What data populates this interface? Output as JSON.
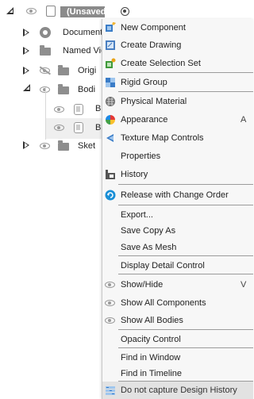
{
  "tree": {
    "root_label": "(Unsaved)",
    "items": [
      {
        "label": "Document"
      },
      {
        "label": "Named Vie"
      },
      {
        "label": "Origi"
      },
      {
        "label": "Bodi"
      },
      {
        "label": "B"
      },
      {
        "label": "B"
      },
      {
        "label": "Sket"
      }
    ]
  },
  "menu": {
    "items": [
      {
        "label": "New Component",
        "icon": "new-component-icon"
      },
      {
        "label": "Create Drawing",
        "icon": "create-drawing-icon"
      },
      {
        "label": "Create Selection Set",
        "icon": "selection-set-icon"
      },
      {
        "label": "Rigid Group",
        "icon": "rigid-group-icon"
      },
      {
        "label": "Physical Material",
        "icon": "physical-material-icon"
      },
      {
        "label": "Appearance",
        "icon": "appearance-icon",
        "shortcut": "A"
      },
      {
        "label": "Texture Map Controls",
        "icon": "texture-map-icon"
      },
      {
        "label": "Properties"
      },
      {
        "label": "History",
        "icon": "history-icon"
      },
      {
        "label": "Release with Change Order",
        "icon": "release-icon"
      },
      {
        "label": "Export..."
      },
      {
        "label": "Save Copy As"
      },
      {
        "label": "Save As Mesh"
      },
      {
        "label": "Display Detail Control"
      },
      {
        "label": "Show/Hide",
        "icon": "eye-icon",
        "shortcut": "V"
      },
      {
        "label": "Show All Components",
        "icon": "eye-icon"
      },
      {
        "label": "Show All Bodies",
        "icon": "eye-icon"
      },
      {
        "label": "Opacity Control"
      },
      {
        "label": "Find in Window"
      },
      {
        "label": "Find in Timeline"
      },
      {
        "label": "Do not capture Design History",
        "icon": "design-history-icon"
      }
    ]
  }
}
